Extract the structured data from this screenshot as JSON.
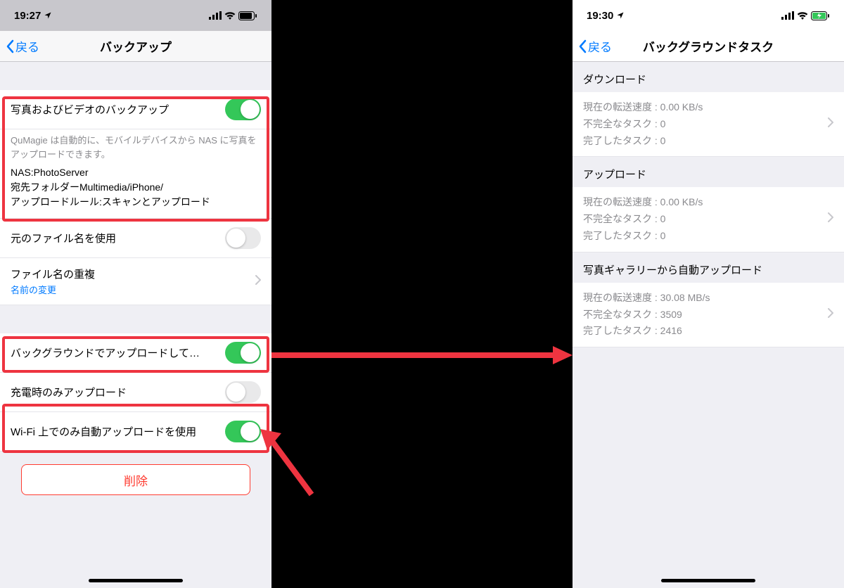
{
  "left": {
    "status_time": "19:27",
    "back_label": "戻る",
    "nav_title": "バックアップ",
    "row_backup": "写真およびビデオのバックアップ",
    "desc1": "QuMagie は自動的に、モバイルデバイスから NAS に写真をアップロードできます。",
    "desc2_l1": "NAS:PhotoServer",
    "desc2_l2": "宛先フォルダーMultimedia/iPhone/",
    "desc2_l3": "アップロードルール:スキャンとアップロード",
    "row_origname": "元のファイル名を使用",
    "row_dup": "ファイル名の重複",
    "row_dup_sub": "名前の変更",
    "row_bg": "バックグラウンドでアップロードして…",
    "row_charge": "充電時のみアップロード",
    "row_wifi": "Wi-Fi 上でのみ自動アップロードを使用",
    "delete": "削除"
  },
  "right": {
    "status_time": "19:30",
    "back_label": "戻る",
    "nav_title": "バックグラウンドタスク",
    "sec_download": "ダウンロード",
    "dl_speed": "現在の転送速度 : 0.00 KB/s",
    "dl_incomplete": "不完全なタスク : 0",
    "dl_done": "完了したタスク : 0",
    "sec_upload": "アップロード",
    "ul_speed": "現在の転送速度 : 0.00 KB/s",
    "ul_incomplete": "不完全なタスク : 0",
    "ul_done": "完了したタスク : 0",
    "sec_auto": "写真ギャラリーから自動アップロード",
    "au_speed": "現在の転送速度 : 30.08 MB/s",
    "au_incomplete": "不完全なタスク : 3509",
    "au_done": "完了したタスク : 2416"
  }
}
